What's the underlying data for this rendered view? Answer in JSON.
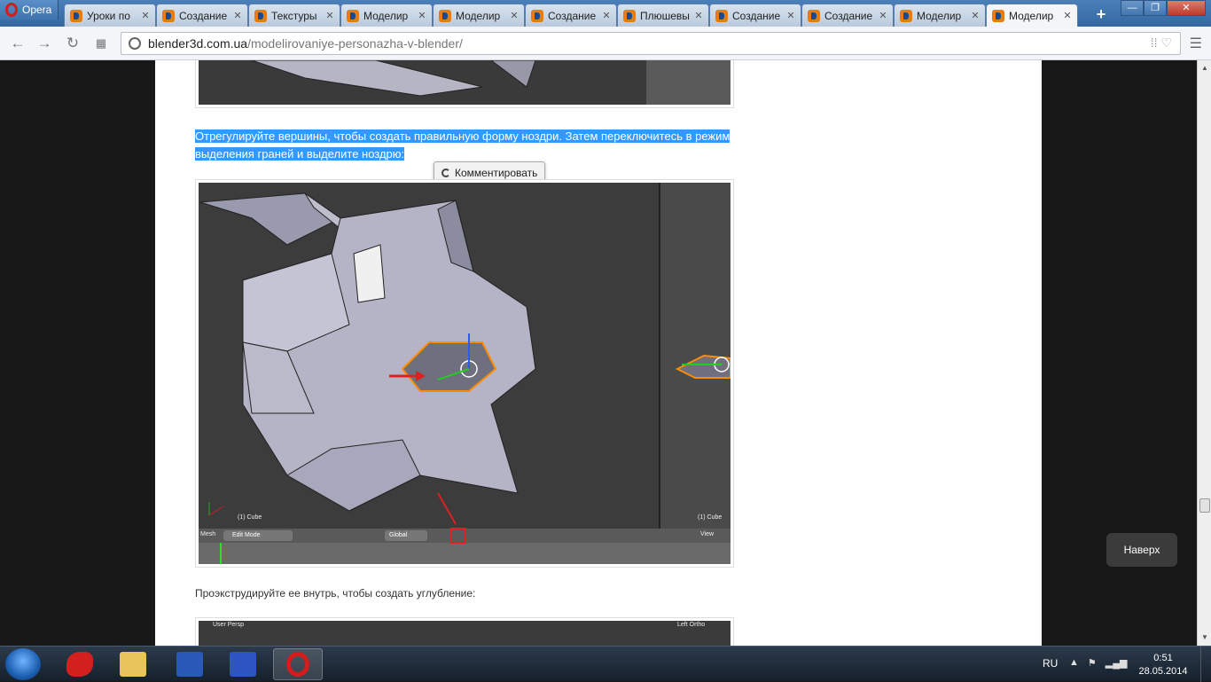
{
  "browser": {
    "menu_label": "Opera",
    "tabs": [
      {
        "label": "Уроки по"
      },
      {
        "label": "Создание"
      },
      {
        "label": "Текстуры"
      },
      {
        "label": "Моделир"
      },
      {
        "label": "Моделир"
      },
      {
        "label": "Создание"
      },
      {
        "label": "Плюшевы"
      },
      {
        "label": "Создание"
      },
      {
        "label": "Создание"
      },
      {
        "label": "Моделир"
      },
      {
        "label": "Моделир"
      }
    ],
    "active_tab_index": 10,
    "new_tab": "+",
    "url_host": "blender3d.com.ua",
    "url_path": "/modelirovaniye-personazha-v-blender/"
  },
  "article": {
    "highlight_line1": "Отрегулируйте вершины, чтобы создать правильную форму ноздри. Затем переключитесь в режим",
    "highlight_line2": "выделения граней и выделите ноздрю:",
    "comment_tooltip": "Комментировать",
    "paragraph2": "Проэкструдируйте ее внутрь, чтобы создать углубление:"
  },
  "blender_screenshot": {
    "object_label_left": "(1) Cube",
    "object_label_right": "(1) Cube",
    "header_mesh": "Mesh",
    "mode": "Edit Mode",
    "orientation": "Global",
    "view_label": "View",
    "bottom_left_label": "User Persp",
    "bottom_right_label": "Left Ortho"
  },
  "scroll_top_button": "Наверх",
  "taskbar": {
    "language": "RU",
    "time": "0:51",
    "date": "28.05.2014"
  },
  "colors": {
    "selection": "#3399ff",
    "taskbar": "#1c2835",
    "tab_strip": "#3e72aa"
  }
}
